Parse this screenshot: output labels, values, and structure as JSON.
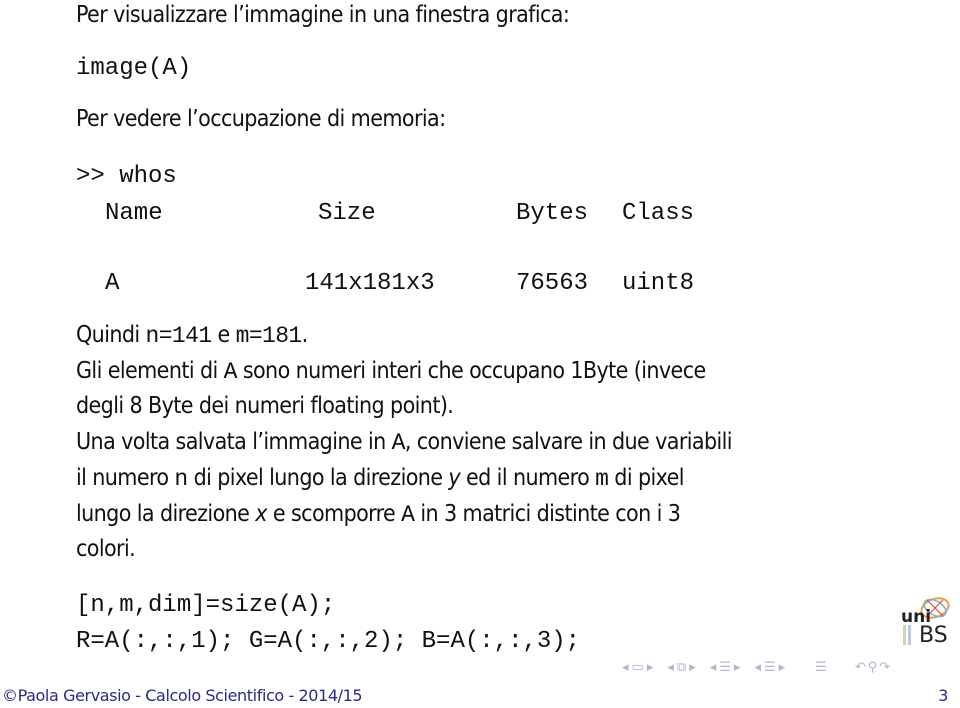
{
  "slide": {
    "line1": "Per visualizzare l’immagine in una finestra grafica:",
    "code1": "image(A)",
    "line2": "Per vedere l’occupazione di memoria:",
    "whos": {
      "prompt": ">> whos",
      "headers": [
        "Name",
        "Size",
        "Bytes",
        "Class"
      ],
      "rows": [
        [
          "A",
          "141x181x3",
          "76563",
          "uint8"
        ]
      ]
    },
    "para1": {
      "t1": "Quindi ",
      "c1": "n=141",
      "t2": " e ",
      "c2": "m=181",
      "t3": "."
    },
    "para2": {
      "t1": "Gli elementi di ",
      "c1": "A",
      "t2": " sono numeri interi che occupano 1Byte (invece",
      "t3": "degli 8 Byte dei numeri floating point)."
    },
    "para3": {
      "l1a": "Una volta salvata l’immagine in ",
      "l1c": "A",
      "l1b": ", conviene salvare in due variabili",
      "l2a": "il numero ",
      "l2c": "n",
      "l2b": " di pixel lungo la direzione ",
      "l2i": "y",
      "l2d": " ed il numero ",
      "l2c2": "m",
      "l2e": " di pixel",
      "l3a": "lungo la direzione ",
      "l3i": "x",
      "l3b": " e scomporre ",
      "l3c": "A",
      "l3d": " in 3 matrici distinte con i 3",
      "l4": "colori."
    },
    "code2": "[n,m,dim]=size(A);",
    "code3": "R=A(:,:,1); G=A(:,:,2); B=A(:,:,3);"
  },
  "logo": {
    "text_uni": "uni",
    "text_bs": "BS"
  },
  "nav": {
    "icons": [
      "nav-prev-frame",
      "frame-icon",
      "nav-next-frame",
      "nav-prev-subsection",
      "subsection-icon",
      "nav-next-subsection",
      "nav-prev-section",
      "section-icon",
      "nav-next-section",
      "nav-prev-doc",
      "doc-icon",
      "nav-next-doc",
      "appendix-icon",
      "back-icon",
      "search-icon",
      "forward-icon"
    ]
  },
  "footer": {
    "copyright_symbol": "©",
    "text": "Paola Gervasio - Calcolo Scientifico - 2014/15",
    "page_number": "3"
  },
  "colors": {
    "text": "#111111",
    "footer": "#2a2a8a",
    "nav": "#b4b4cf"
  }
}
